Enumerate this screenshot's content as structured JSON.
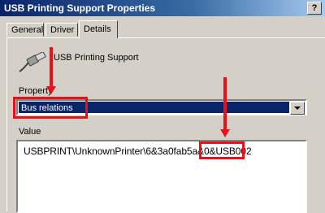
{
  "window": {
    "title": "USB Printing Support Properties",
    "help_button": "?"
  },
  "tabs": [
    {
      "label": "General",
      "active": false
    },
    {
      "label": "Driver",
      "active": false
    },
    {
      "label": "Details",
      "active": true
    }
  ],
  "device": {
    "icon": "usb-connector-icon",
    "name": "USB Printing Support"
  },
  "property": {
    "label": "Property",
    "selected": "Bus relations"
  },
  "value": {
    "label": "Value",
    "text": "USBPRINT\\UnknownPrinter\\6&3a0fab5a&0&USB002"
  },
  "annotations": {
    "color": "#e8101a"
  }
}
